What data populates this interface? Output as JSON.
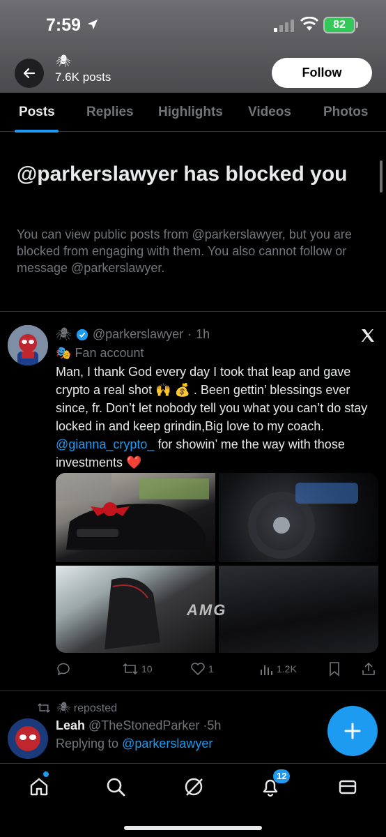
{
  "status_bar": {
    "time": "7:59",
    "battery": "82"
  },
  "header": {
    "profile_emoji": "🕷",
    "posts_count": "7.6K posts",
    "follow_label": "Follow"
  },
  "tabs": [
    {
      "label": "Posts",
      "active": true
    },
    {
      "label": "Replies",
      "active": false
    },
    {
      "label": "Highlights",
      "active": false
    },
    {
      "label": "Videos",
      "active": false
    },
    {
      "label": "Photos",
      "active": false
    }
  ],
  "blocked_notice": {
    "title": "@parkerslawyer has blocked you",
    "description": "You can view public posts from @parkerslawyer, but you are blocked from engaging with them. You also cannot follow or message @parkerslawyer."
  },
  "post": {
    "author_emoji": "🕷",
    "handle": "@parkerslawyer",
    "time": "1h",
    "fan_label": "Fan account",
    "text_before": "Man, I thank God every day I took that leap and gave crypto a real shot 🙌 💰 . Been gettin’ blessings ever since, fr. Don’t let nobody tell you what you can’t do stay locked in and keep grindin,Big love to my coach.",
    "mention": "@gianna_crypto_",
    "text_after": " for showin’ me the way with those investments ❤️",
    "media_badge_text": "AMG",
    "stats": {
      "retweets": "10",
      "likes": "1",
      "views": "1.2K"
    }
  },
  "repost": {
    "label": "🕷 reposted",
    "name": "Leah",
    "handle": "@TheStonedParker",
    "time": "5h",
    "replying_to_label": "Replying to",
    "replying_to": "@parkerslawyer"
  },
  "bottom_nav": {
    "notifications_badge": "12"
  },
  "colors": {
    "accent": "#1d9bf0",
    "background": "#000000",
    "muted": "#71767b",
    "text": "#e7e9ea"
  }
}
